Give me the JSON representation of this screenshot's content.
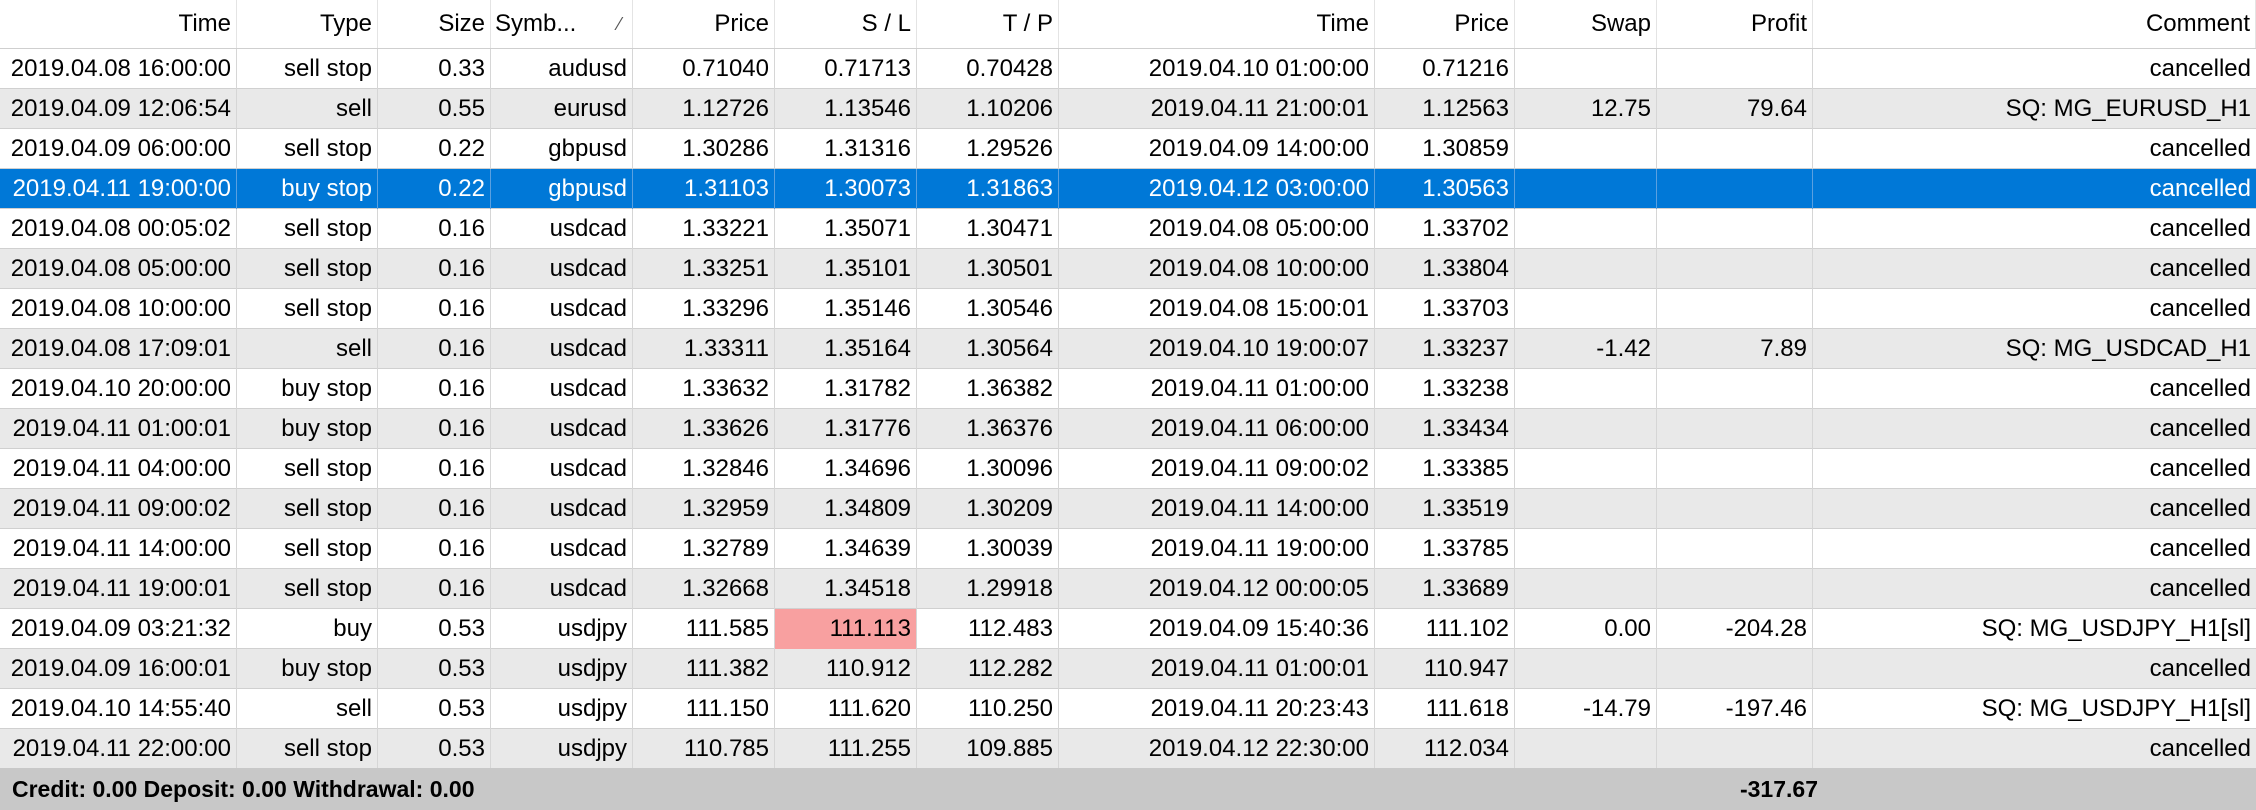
{
  "columns": {
    "time": "Time",
    "type": "Type",
    "size": "Size",
    "symbol": "Symb...",
    "symbol_sort_icon": "sort-ascending-icon",
    "price": "Price",
    "sl": "S / L",
    "tp": "T / P",
    "close_time": "Time",
    "close_price": "Price",
    "swap": "Swap",
    "profit": "Profit",
    "comment": "Comment"
  },
  "rows": [
    {
      "time": "2019.04.08 16:00:00",
      "type": "sell stop",
      "size": "0.33",
      "symbol": "audusd",
      "price": "0.71040",
      "sl": "0.71713",
      "tp": "0.70428",
      "close_time": "2019.04.10 01:00:00",
      "close_price": "0.71216",
      "swap": "",
      "profit": "",
      "comment": "cancelled"
    },
    {
      "time": "2019.04.09 12:06:54",
      "type": "sell",
      "size": "0.55",
      "symbol": "eurusd",
      "price": "1.12726",
      "sl": "1.13546",
      "tp": "1.10206",
      "close_time": "2019.04.11 21:00:01",
      "close_price": "1.12563",
      "swap": "12.75",
      "profit": "79.64",
      "comment": "SQ: MG_EURUSD_H1"
    },
    {
      "time": "2019.04.09 06:00:00",
      "type": "sell stop",
      "size": "0.22",
      "symbol": "gbpusd",
      "price": "1.30286",
      "sl": "1.31316",
      "tp": "1.29526",
      "close_time": "2019.04.09 14:00:00",
      "close_price": "1.30859",
      "swap": "",
      "profit": "",
      "comment": "cancelled"
    },
    {
      "time": "2019.04.11 19:00:00",
      "type": "buy stop",
      "size": "0.22",
      "symbol": "gbpusd",
      "price": "1.31103",
      "sl": "1.30073",
      "tp": "1.31863",
      "close_time": "2019.04.12 03:00:00",
      "close_price": "1.30563",
      "swap": "",
      "profit": "",
      "comment": "cancelled",
      "selected": true
    },
    {
      "time": "2019.04.08 00:05:02",
      "type": "sell stop",
      "size": "0.16",
      "symbol": "usdcad",
      "price": "1.33221",
      "sl": "1.35071",
      "tp": "1.30471",
      "close_time": "2019.04.08 05:00:00",
      "close_price": "1.33702",
      "swap": "",
      "profit": "",
      "comment": "cancelled"
    },
    {
      "time": "2019.04.08 05:00:00",
      "type": "sell stop",
      "size": "0.16",
      "symbol": "usdcad",
      "price": "1.33251",
      "sl": "1.35101",
      "tp": "1.30501",
      "close_time": "2019.04.08 10:00:00",
      "close_price": "1.33804",
      "swap": "",
      "profit": "",
      "comment": "cancelled"
    },
    {
      "time": "2019.04.08 10:00:00",
      "type": "sell stop",
      "size": "0.16",
      "symbol": "usdcad",
      "price": "1.33296",
      "sl": "1.35146",
      "tp": "1.30546",
      "close_time": "2019.04.08 15:00:01",
      "close_price": "1.33703",
      "swap": "",
      "profit": "",
      "comment": "cancelled"
    },
    {
      "time": "2019.04.08 17:09:01",
      "type": "sell",
      "size": "0.16",
      "symbol": "usdcad",
      "price": "1.33311",
      "sl": "1.35164",
      "tp": "1.30564",
      "close_time": "2019.04.10 19:00:07",
      "close_price": "1.33237",
      "swap": "-1.42",
      "profit": "7.89",
      "comment": "SQ: MG_USDCAD_H1"
    },
    {
      "time": "2019.04.10 20:00:00",
      "type": "buy stop",
      "size": "0.16",
      "symbol": "usdcad",
      "price": "1.33632",
      "sl": "1.31782",
      "tp": "1.36382",
      "close_time": "2019.04.11 01:00:00",
      "close_price": "1.33238",
      "swap": "",
      "profit": "",
      "comment": "cancelled"
    },
    {
      "time": "2019.04.11 01:00:01",
      "type": "buy stop",
      "size": "0.16",
      "symbol": "usdcad",
      "price": "1.33626",
      "sl": "1.31776",
      "tp": "1.36376",
      "close_time": "2019.04.11 06:00:00",
      "close_price": "1.33434",
      "swap": "",
      "profit": "",
      "comment": "cancelled"
    },
    {
      "time": "2019.04.11 04:00:00",
      "type": "sell stop",
      "size": "0.16",
      "symbol": "usdcad",
      "price": "1.32846",
      "sl": "1.34696",
      "tp": "1.30096",
      "close_time": "2019.04.11 09:00:02",
      "close_price": "1.33385",
      "swap": "",
      "profit": "",
      "comment": "cancelled"
    },
    {
      "time": "2019.04.11 09:00:02",
      "type": "sell stop",
      "size": "0.16",
      "symbol": "usdcad",
      "price": "1.32959",
      "sl": "1.34809",
      "tp": "1.30209",
      "close_time": "2019.04.11 14:00:00",
      "close_price": "1.33519",
      "swap": "",
      "profit": "",
      "comment": "cancelled"
    },
    {
      "time": "2019.04.11 14:00:00",
      "type": "sell stop",
      "size": "0.16",
      "symbol": "usdcad",
      "price": "1.32789",
      "sl": "1.34639",
      "tp": "1.30039",
      "close_time": "2019.04.11 19:00:00",
      "close_price": "1.33785",
      "swap": "",
      "profit": "",
      "comment": "cancelled"
    },
    {
      "time": "2019.04.11 19:00:01",
      "type": "sell stop",
      "size": "0.16",
      "symbol": "usdcad",
      "price": "1.32668",
      "sl": "1.34518",
      "tp": "1.29918",
      "close_time": "2019.04.12 00:00:05",
      "close_price": "1.33689",
      "swap": "",
      "profit": "",
      "comment": "cancelled"
    },
    {
      "time": "2019.04.09 03:21:32",
      "type": "buy",
      "size": "0.53",
      "symbol": "usdjpy",
      "price": "111.585",
      "sl": "111.113",
      "tp": "112.483",
      "close_time": "2019.04.09 15:40:36",
      "close_price": "111.102",
      "swap": "0.00",
      "profit": "-204.28",
      "comment": "SQ: MG_USDJPY_H1[sl]",
      "sl_hit": true
    },
    {
      "time": "2019.04.09 16:00:01",
      "type": "buy stop",
      "size": "0.53",
      "symbol": "usdjpy",
      "price": "111.382",
      "sl": "110.912",
      "tp": "112.282",
      "close_time": "2019.04.11 01:00:01",
      "close_price": "110.947",
      "swap": "",
      "profit": "",
      "comment": "cancelled"
    },
    {
      "time": "2019.04.10 14:55:40",
      "type": "sell",
      "size": "0.53",
      "symbol": "usdjpy",
      "price": "111.150",
      "sl": "111.620",
      "tp": "110.250",
      "close_time": "2019.04.11 20:23:43",
      "close_price": "111.618",
      "swap": "-14.79",
      "profit": "-197.46",
      "comment": "SQ: MG_USDJPY_H1[sl]"
    },
    {
      "time": "2019.04.11 22:00:00",
      "type": "sell stop",
      "size": "0.53",
      "symbol": "usdjpy",
      "price": "110.785",
      "sl": "111.255",
      "tp": "109.885",
      "close_time": "2019.04.12 22:30:00",
      "close_price": "112.034",
      "swap": "",
      "profit": "",
      "comment": "cancelled"
    }
  ],
  "footer": {
    "summary": "Credit: 0.00  Deposit: 0.00  Withdrawal: 0.00",
    "total_profit": "-317.67"
  },
  "colors": {
    "selection": "#0078d7",
    "stripe": "#e9e9e9",
    "sl_highlight": "#f8a0a0",
    "footer_bg": "#c8c8c8"
  }
}
